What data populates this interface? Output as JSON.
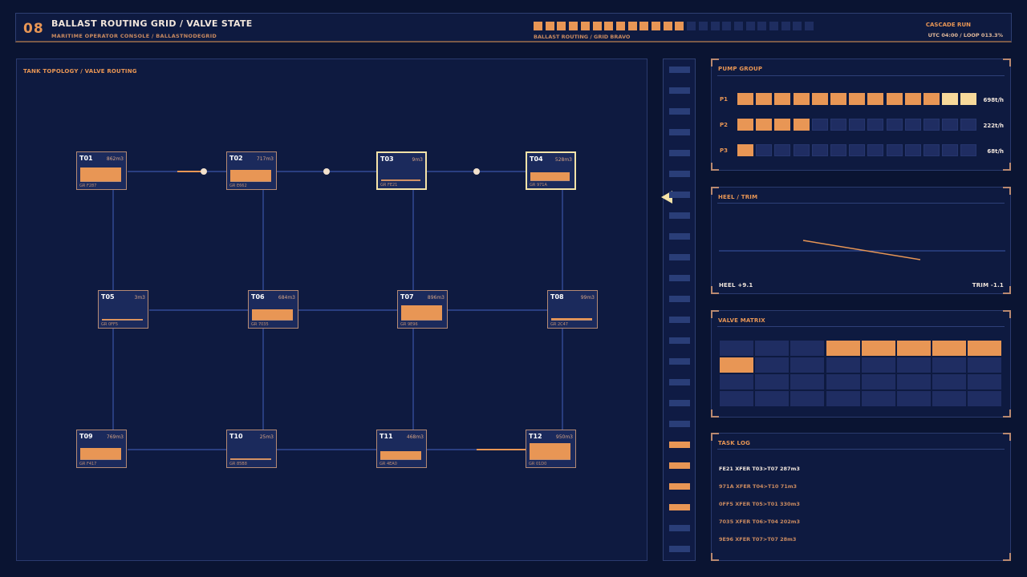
{
  "header": {
    "number": "08",
    "title": "BALLAST ROUTING GRID / VALVE STATE",
    "subtitle": "MARITIME OPERATOR CONSOLE / BALLASTNODEGRID",
    "progress_label": "BALLAST ROUTING / GRID BRAVO",
    "progress_filled": 13,
    "progress_total": 24,
    "mode": "CASCADE RUN",
    "status": "UTC 04:00 / LOOP 013.3%"
  },
  "topology": {
    "title": "TANK TOPOLOGY / VALVE ROUTING",
    "tanks": [
      {
        "id": "T01",
        "vol": "862m3",
        "gr": "GR F287",
        "level": 0.6
      },
      {
        "id": "T02",
        "vol": "717m3",
        "gr": "GR E662",
        "level": 0.5
      },
      {
        "id": "T03",
        "vol": "9m3",
        "gr": "GR FE21",
        "level": 0.01
      },
      {
        "id": "T04",
        "vol": "528m3",
        "gr": "GR 971A",
        "level": 0.35
      },
      {
        "id": "T05",
        "vol": "3m3",
        "gr": "GR 0FF5",
        "level": 0.01
      },
      {
        "id": "T06",
        "vol": "684m3",
        "gr": "GR 7035",
        "level": 0.45
      },
      {
        "id": "T07",
        "vol": "896m3",
        "gr": "GR 9E96",
        "level": 0.65
      },
      {
        "id": "T08",
        "vol": "99m3",
        "gr": "GR 2C47",
        "level": 0.08
      },
      {
        "id": "T09",
        "vol": "769m3",
        "gr": "GR F417",
        "level": 0.5
      },
      {
        "id": "T10",
        "vol": "25m3",
        "gr": "GR 85B8",
        "level": 0.02
      },
      {
        "id": "T11",
        "vol": "468m3",
        "gr": "GR 4EA0",
        "level": 0.35
      },
      {
        "id": "T12",
        "vol": "950m3",
        "gr": "GR 01D0",
        "level": 0.7
      }
    ]
  },
  "pumps": {
    "title": "PUMP GROUP",
    "items": [
      {
        "label": "P1",
        "value": "698t/h",
        "on": 11,
        "hi": 2
      },
      {
        "label": "P2",
        "value": "222t/h",
        "on": 4,
        "hi": 0
      },
      {
        "label": "P3",
        "value": "68t/h",
        "on": 1,
        "hi": 0
      }
    ]
  },
  "heel": {
    "title": "HEEL / TRIM",
    "heel": "HEEL +9.1",
    "trim": "TRIM -1.1"
  },
  "valves": {
    "title": "VALVE MATRIX",
    "rows": [
      [
        0,
        0,
        0,
        1,
        1,
        1,
        1,
        1
      ],
      [
        1,
        0,
        0,
        0,
        0,
        0,
        0,
        0
      ],
      [
        0,
        0,
        0,
        0,
        0,
        0,
        0,
        0
      ],
      [
        0,
        0,
        0,
        0,
        0,
        0,
        0,
        0
      ]
    ]
  },
  "log": {
    "title": "TASK LOG",
    "entries": [
      "FE21 XFER T03>T07 287m3",
      "971A XFER T04>T10 71m3",
      "0FF5 XFER T05>T01 330m3",
      "7035 XFER T06>T04 202m3",
      "9E96 XFER T07>T07 28m3"
    ]
  },
  "colors": {
    "accent": "#e89655",
    "highlight": "#f7d99a",
    "panel": "#0e1a40",
    "background": "#0a1432"
  }
}
